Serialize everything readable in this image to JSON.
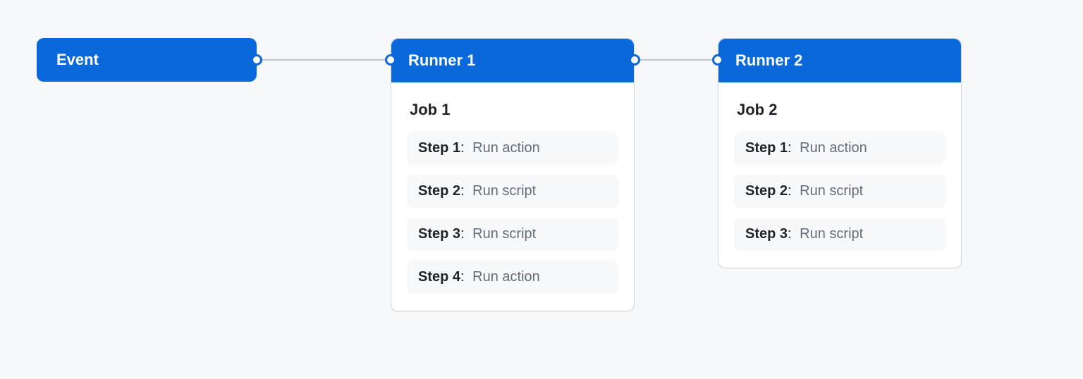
{
  "colors": {
    "accent": "#0969da",
    "line": "#bcc3cd",
    "card_border": "#d0d7de",
    "bg": "#f6f8fa",
    "text_muted": "#656d76"
  },
  "event": {
    "label": "Event"
  },
  "runners": [
    {
      "title": "Runner 1",
      "job": {
        "title": "Job 1",
        "steps": [
          {
            "label": "Step 1",
            "desc": "Run action"
          },
          {
            "label": "Step 2",
            "desc": "Run script"
          },
          {
            "label": "Step 3",
            "desc": "Run script"
          },
          {
            "label": "Step 4",
            "desc": "Run action"
          }
        ]
      }
    },
    {
      "title": "Runner 2",
      "job": {
        "title": "Job 2",
        "steps": [
          {
            "label": "Step 1",
            "desc": "Run action"
          },
          {
            "label": "Step 2",
            "desc": "Run script"
          },
          {
            "label": "Step 3",
            "desc": "Run script"
          }
        ]
      }
    }
  ]
}
